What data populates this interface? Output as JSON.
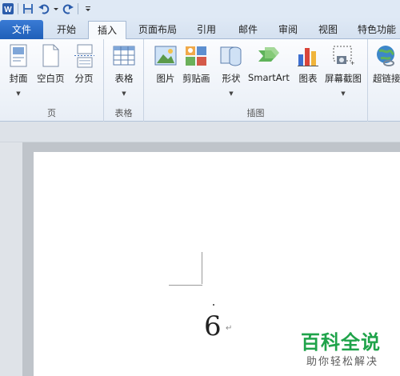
{
  "qat": {
    "icons": [
      "word-app-icon",
      "save-icon",
      "undo-icon",
      "redo-icon",
      "customize-icon"
    ]
  },
  "tabs": [
    {
      "label": "文件",
      "id": "file"
    },
    {
      "label": "开始",
      "id": "home"
    },
    {
      "label": "插入",
      "id": "insert",
      "active": true
    },
    {
      "label": "页面布局",
      "id": "page-layout"
    },
    {
      "label": "引用",
      "id": "references"
    },
    {
      "label": "邮件",
      "id": "mailings"
    },
    {
      "label": "审阅",
      "id": "review"
    },
    {
      "label": "视图",
      "id": "view"
    },
    {
      "label": "特色功能",
      "id": "features"
    }
  ],
  "ribbon": {
    "groups": [
      {
        "label": "页",
        "buttons": [
          "封面",
          "空白页",
          "分页"
        ]
      },
      {
        "label": "表格",
        "buttons": [
          "表格"
        ]
      },
      {
        "label": "插图",
        "buttons": [
          "图片",
          "剪贴画",
          "形状",
          "SmartArt",
          "图表",
          "屏幕截图"
        ]
      },
      {
        "label": "",
        "buttons": [
          "超链接"
        ]
      }
    ]
  },
  "document": {
    "content": "6",
    "paragraph_mark": "↵"
  },
  "watermark": {
    "title": "百科全说",
    "subtitle": "助你轻松解决"
  },
  "colors": {
    "file_tab": "#2a6fc9",
    "watermark": "#1fa34a"
  }
}
